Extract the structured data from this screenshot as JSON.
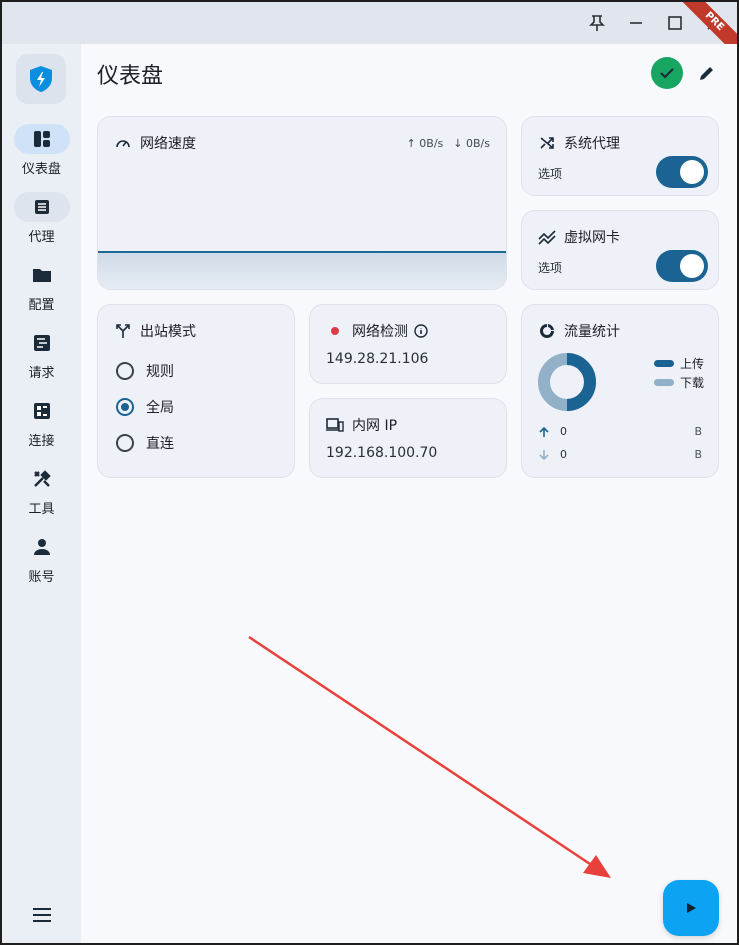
{
  "window": {
    "badge": "PRE"
  },
  "sidebar": {
    "items": [
      {
        "label": "仪表盘",
        "icon": "dashboard-icon",
        "active": true
      },
      {
        "label": "代理",
        "icon": "proxy-icon",
        "hover": true
      },
      {
        "label": "配置",
        "icon": "folder-icon"
      },
      {
        "label": "请求",
        "icon": "requests-icon"
      },
      {
        "label": "连接",
        "icon": "connections-icon"
      },
      {
        "label": "工具",
        "icon": "tools-icon"
      },
      {
        "label": "账号",
        "icon": "account-icon"
      }
    ]
  },
  "header": {
    "title": "仪表盘"
  },
  "network_speed": {
    "title": "网络速度",
    "upload": "↑ 0B/s",
    "download": "↓ 0B/s"
  },
  "system_proxy": {
    "title": "系统代理",
    "sub": "选项",
    "enabled": true
  },
  "virtual_nic": {
    "title": "虚拟网卡",
    "sub": "选项",
    "enabled": true
  },
  "outbound_mode": {
    "title": "出站模式",
    "options": [
      "规则",
      "全局",
      "直连"
    ],
    "selected": "全局"
  },
  "network_check": {
    "title": "网络检测",
    "value": "149.28.21.106",
    "status_color": "#e0394a"
  },
  "lan_ip": {
    "title": "内网 IP",
    "value": "192.168.100.70"
  },
  "traffic_stats": {
    "title": "流量统计",
    "legend": [
      {
        "label": "上传",
        "color": "#1a6393"
      },
      {
        "label": "下载",
        "color": "#93b0c9"
      }
    ],
    "upload_value": "0",
    "download_value": "0",
    "unit": "B"
  },
  "colors": {
    "accent": "#1a6393",
    "fab": "#0ba3f2",
    "success": "#16a662",
    "annotation": "#e8413c"
  }
}
